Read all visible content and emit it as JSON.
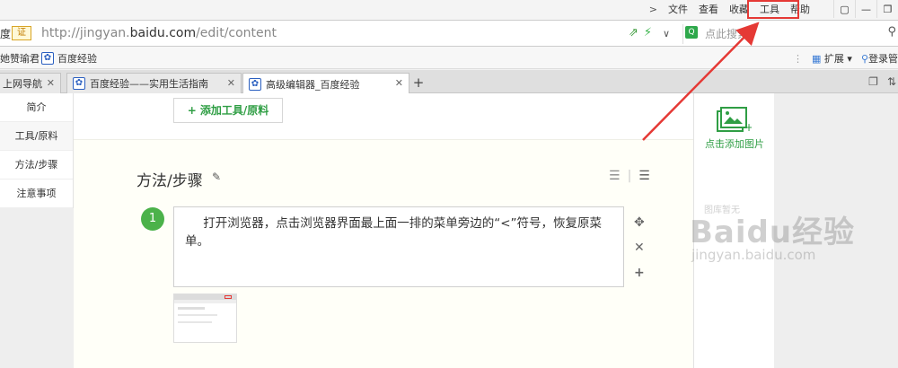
{
  "menubar": {
    "arrow": ">",
    "items": [
      "文件",
      "查看",
      "收藏",
      "工具",
      "帮助"
    ],
    "win_buttons": [
      "shirt",
      "minimize",
      "restore"
    ]
  },
  "addressbar": {
    "prefix": "度",
    "cert_label": "证",
    "url_host_prefix": "http://jingyan.",
    "url_host": "baidu.com",
    "url_path": "/edit/content",
    "search_placeholder": "点此搜索"
  },
  "bookmarks": {
    "items": [
      {
        "label": "她赞瑜君",
        "icon": "none"
      },
      {
        "label": "百度经验",
        "icon": "paw-icon"
      }
    ],
    "right": {
      "extend_label": "扩展",
      "login_label": "登录管"
    }
  },
  "tabs": {
    "items": [
      {
        "label": "上网导航",
        "active": false
      },
      {
        "label": "百度经验——实用生活指南",
        "active": false
      },
      {
        "label": "高级编辑器_百度经验",
        "active": true
      }
    ],
    "new_tab": "+"
  },
  "leftnav": {
    "items": [
      "简介",
      "工具/原料",
      "方法/步骤",
      "注意事项"
    ],
    "active_index": 1
  },
  "editor": {
    "add_tool_label": "+ 添加工具/原料",
    "section_title": "方法/步骤",
    "step": {
      "number": "1",
      "text": "打开浏览器，点击浏览器界面最上面一排的菜单旁边的“<”符号，恢复原菜单。"
    },
    "step_actions": [
      "move",
      "delete",
      "add"
    ]
  },
  "rightpanel": {
    "add_image_label": "点击添加图片"
  },
  "watermark": {
    "small": "图库暂无",
    "brand": "Baidu经验",
    "domain": "jingyan.baidu.com"
  },
  "colors": {
    "accent_green": "#2f9e44",
    "step_green": "#4bb24a",
    "highlight_red": "#e53935"
  }
}
